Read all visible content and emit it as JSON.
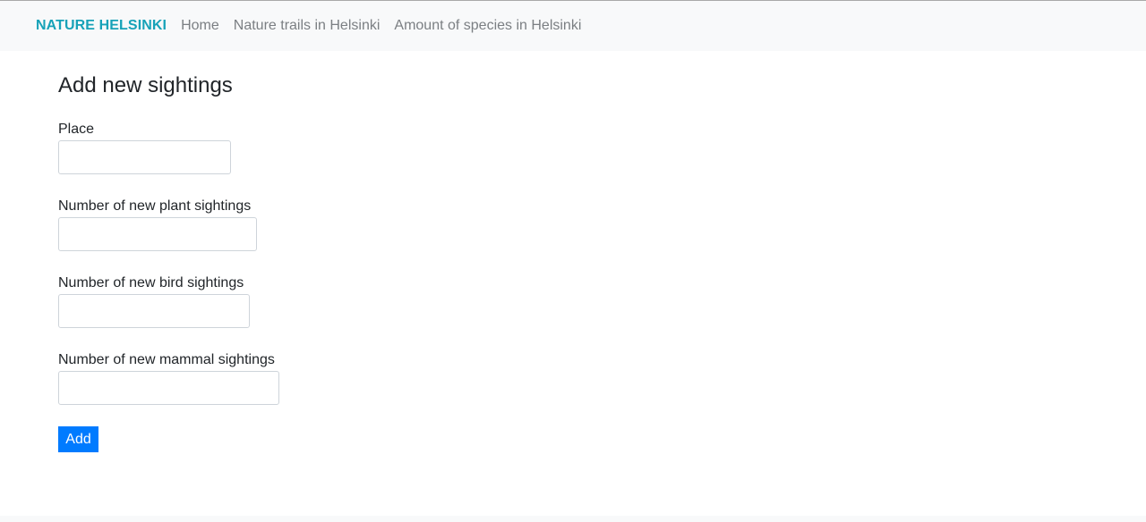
{
  "navbar": {
    "brand": "NATURE HELSINKI",
    "links": [
      {
        "label": "Home"
      },
      {
        "label": "Nature trails in Helsinki"
      },
      {
        "label": "Amount of species in Helsinki"
      }
    ]
  },
  "form": {
    "title": "Add new sightings",
    "fields": [
      {
        "label": "Place",
        "value": "",
        "placeholder": ""
      },
      {
        "label": "Number of new plant sightings",
        "value": "",
        "placeholder": ""
      },
      {
        "label": "Number of new bird sightings",
        "value": "",
        "placeholder": ""
      },
      {
        "label": "Number of new mammal sightings",
        "value": "",
        "placeholder": ""
      }
    ],
    "submit_label": "Add"
  },
  "colors": {
    "brand": "#17a2b8",
    "nav_link": "#7b7f83",
    "navbar_bg": "#f8f9fa",
    "button_bg": "#007bff"
  }
}
